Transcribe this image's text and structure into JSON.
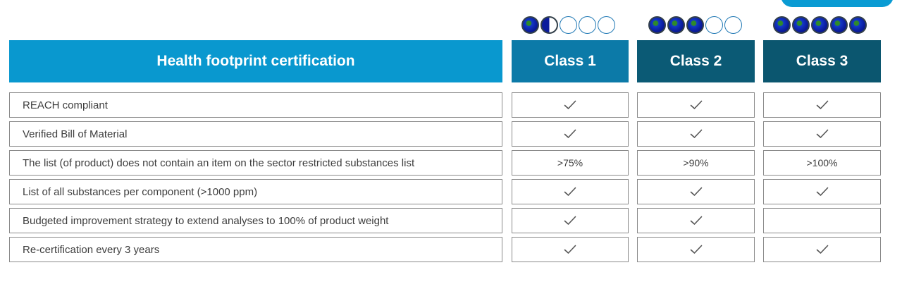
{
  "header": {
    "title": "Health footprint certification",
    "classes": [
      {
        "label": "Class 1",
        "rating": 1.5,
        "rating_max": 5,
        "color": "#0c7aa8"
      },
      {
        "label": "Class 2",
        "rating": 3,
        "rating_max": 5,
        "color": "#0b5a75"
      },
      {
        "label": "Class 3",
        "rating": 5,
        "rating_max": 5,
        "color": "#0b566f"
      }
    ],
    "title_color": "#0998cf"
  },
  "rows": [
    {
      "label": "REACH compliant",
      "cells": [
        "check",
        "check",
        "check"
      ]
    },
    {
      "label": "Verified Bill of Material",
      "cells": [
        "check",
        "check",
        "check"
      ]
    },
    {
      "label": "The list (of product) does not contain an item on the sector restricted substances list",
      "cells": [
        ">75%",
        ">90%",
        ">100%"
      ]
    },
    {
      "label": "List of all substances per component (>1000 ppm)",
      "cells": [
        "check",
        "check",
        "check"
      ]
    },
    {
      "label": "Budgeted improvement strategy to extend analyses to 100% of product weight",
      "cells": [
        "check",
        "check",
        ""
      ]
    },
    {
      "label": "Re-certification every 3 years",
      "cells": [
        "check",
        "check",
        "check"
      ]
    }
  ]
}
